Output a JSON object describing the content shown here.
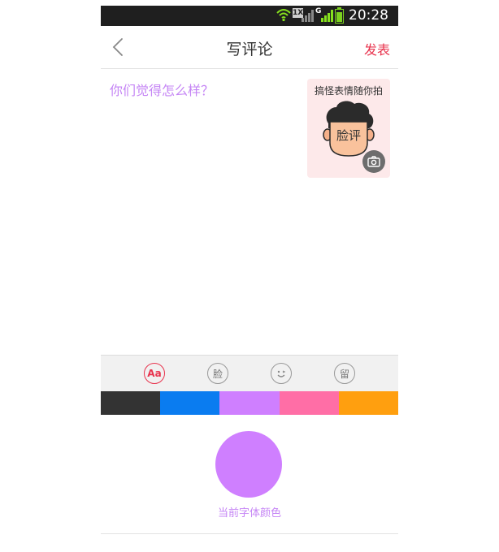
{
  "status_bar": {
    "time": "20:28",
    "network_badge": "1X",
    "network_type": "G",
    "battery_level": 0.75,
    "icons": [
      "wifi-icon",
      "signal-icon",
      "battery-icon"
    ]
  },
  "header": {
    "title": "写评论",
    "publish_label": "发表",
    "back_icon": "chevron-left-icon"
  },
  "editor": {
    "placeholder": "你们觉得怎么样？"
  },
  "face_card": {
    "caption": "搞怪表情随你拍",
    "face_text": "脸评",
    "camera_icon": "camera-icon"
  },
  "toolbar": {
    "items": [
      {
        "label": "Aa",
        "icon": "font-color-icon",
        "active": true
      },
      {
        "label": "脸",
        "icon": "face-comment-icon",
        "active": false
      },
      {
        "label": "",
        "icon": "emoji-icon",
        "active": false
      },
      {
        "label": "留",
        "icon": "message-icon",
        "active": false
      }
    ]
  },
  "palette": {
    "colors": [
      "#333333",
      "#0a7cf0",
      "#cf7fff",
      "#ff6ea6",
      "#ff9f0f"
    ]
  },
  "current_color": {
    "label": "当前字体颜色",
    "color": "#cf7fff"
  },
  "colors": {
    "accent": "#e8344e",
    "placeholder": "#c585f5",
    "card_bg": "#fde9ea"
  }
}
